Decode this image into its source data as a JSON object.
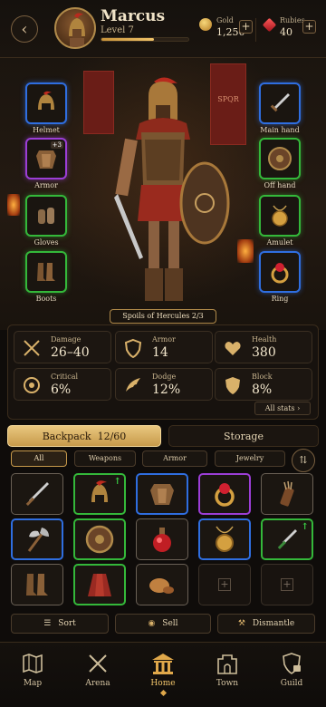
{
  "header": {
    "player_name": "Marcus",
    "level": "Level 7",
    "xp_fraction": 0.6,
    "gold_label": "Gold",
    "gold_value": "1,250",
    "rubies_label": "Rubies",
    "rubies_value": "40"
  },
  "equipment": {
    "helmet": "Helmet",
    "armor": "Armor",
    "armor_plus": "+3",
    "gloves": "Gloves",
    "boots": "Boots",
    "main_hand": "Main hand",
    "off_hand": "Off hand",
    "amulet": "Amulet",
    "ring": "Ring",
    "set_bonus": "Spoils of Hercules 2/3",
    "banner_text": "SPQR"
  },
  "stats": {
    "damage_label": "Damage",
    "damage_value": "26–40",
    "armor_label": "Armor",
    "armor_value": "14",
    "health_label": "Health",
    "health_value": "380",
    "critical_label": "Critical",
    "critical_value": "6%",
    "dodge_label": "Dodge",
    "dodge_value": "12%",
    "block_label": "Block",
    "block_value": "8%",
    "all_stats": "All stats"
  },
  "tabs": {
    "backpack": "Backpack",
    "backpack_count": "12/60",
    "storage": "Storage"
  },
  "filters": {
    "all": "All",
    "weapons": "Weapons",
    "armor": "Armor",
    "jewelry": "Jewelry"
  },
  "actions": {
    "sort": "Sort",
    "sell": "Sell",
    "dismantle": "Dismantle"
  },
  "nav": {
    "map": "Map",
    "arena": "Arena",
    "home": "Home",
    "town": "Town",
    "guild": "Guild"
  },
  "colors": {
    "accent": "#d9b16a",
    "rare": "#2f6ee0",
    "uncommon": "#34b83a",
    "epic": "#9b3ed6"
  }
}
